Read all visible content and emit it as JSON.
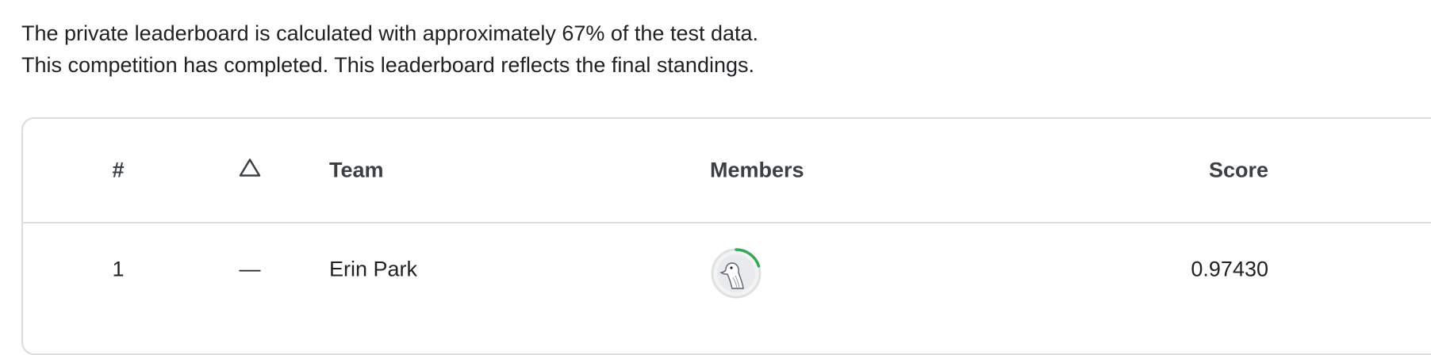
{
  "intro": {
    "line1": "The private leaderboard is calculated with approximately 67% of the test data.",
    "line2": "This competition has completed. This leaderboard reflects the final standings."
  },
  "table": {
    "headers": {
      "rank": "#",
      "delta_icon": "triangle-up-outline-icon",
      "team": "Team",
      "members": "Members",
      "score": "Score"
    },
    "rows": [
      {
        "rank": "1",
        "delta": "—",
        "team": "Erin Park",
        "member_avatar_icon": "goose-avatar-icon",
        "avatar_progress": 0.2,
        "score": "0.97430"
      }
    ]
  },
  "colors": {
    "border": "#dadce0",
    "accent_green": "#34a853",
    "text": "#202124",
    "header_text": "#3c4043"
  }
}
